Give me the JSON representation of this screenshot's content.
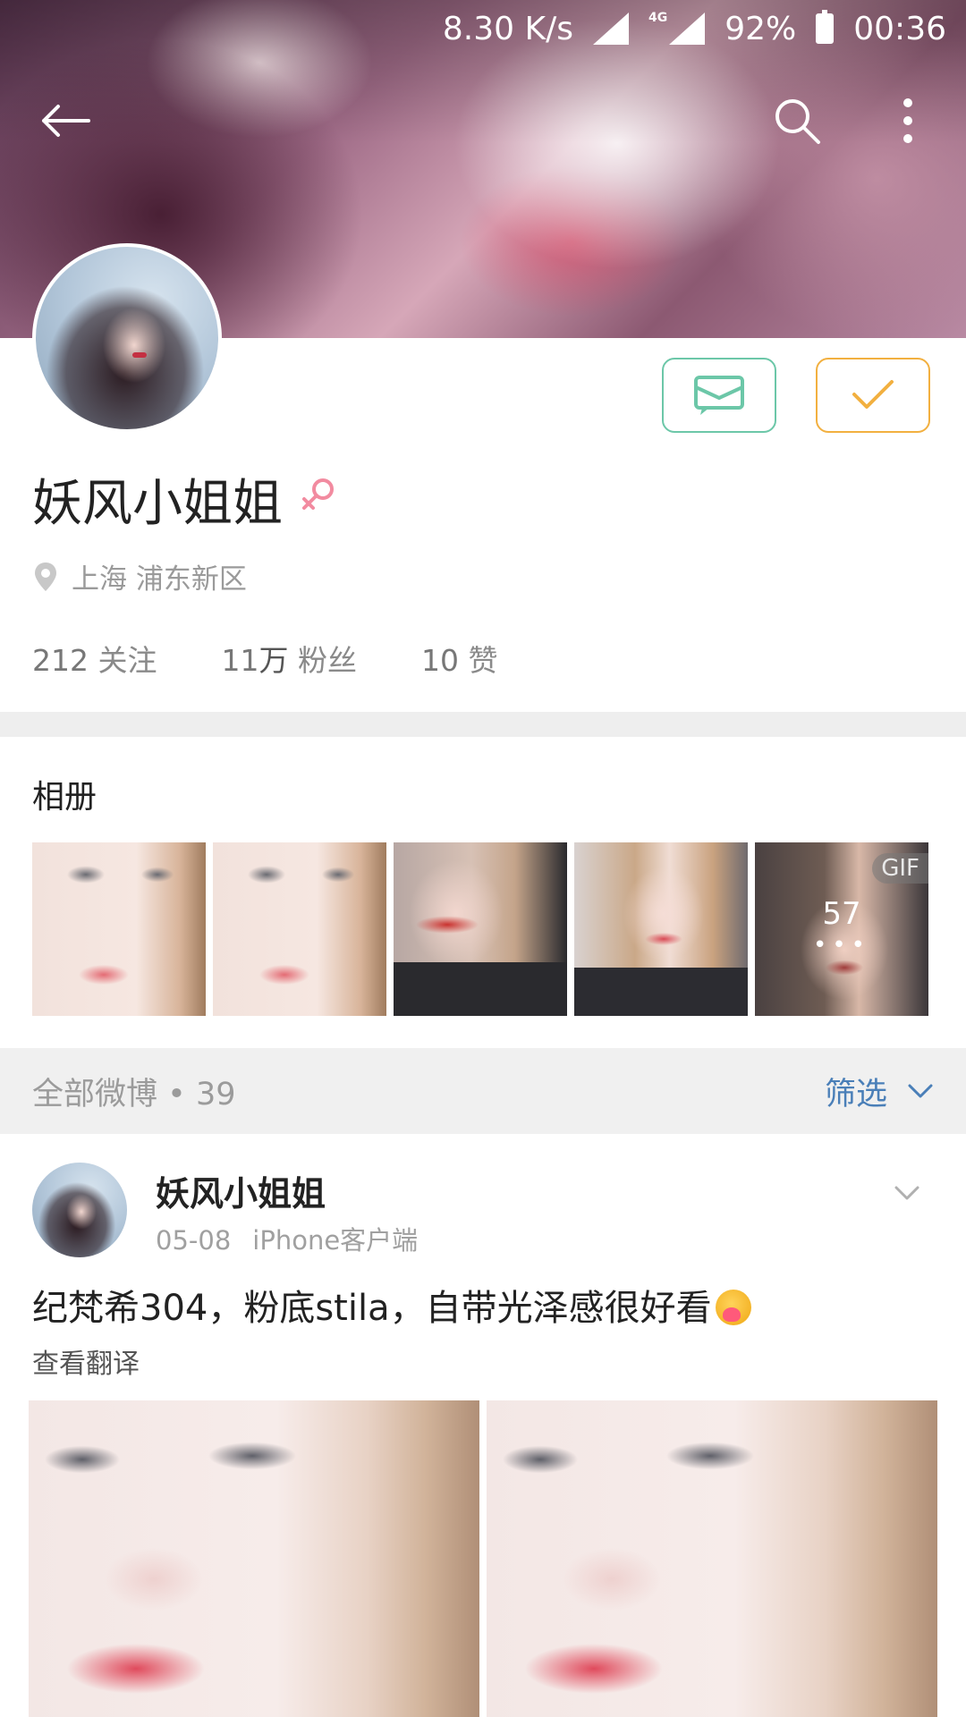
{
  "status_bar": {
    "net_speed": "8.30 K/s",
    "network_type": "4G",
    "battery": "92%",
    "time": "00:36"
  },
  "toolbar": {
    "back_icon": "back-arrow-icon",
    "search_icon": "search-icon",
    "more_icon": "more-vertical-icon"
  },
  "profile": {
    "username": "妖风小姐姐",
    "gender_icon": "female-icon",
    "location": "上海 浦东新区",
    "stats": {
      "following_num": "212",
      "following_label": "关注",
      "followers_num": "11",
      "followers_unit": "万",
      "followers_label": "粉丝",
      "likes_num": "10",
      "likes_label": "赞"
    },
    "accent_message": "#6cc7a8",
    "accent_follow": "#f2b040"
  },
  "album": {
    "title": "相册",
    "gif_badge": "GIF",
    "more_count": "57",
    "more_dots": "•••"
  },
  "feed": {
    "filter_label": "全部微博",
    "separator": "•",
    "count": "39",
    "filter_button": "筛选"
  },
  "post": {
    "author": "妖风小姐姐",
    "date": "05-08",
    "source": "iPhone客户端",
    "text": "纪梵希304，粉底stila，自带光泽感很好看",
    "translate": "查看翻译"
  }
}
